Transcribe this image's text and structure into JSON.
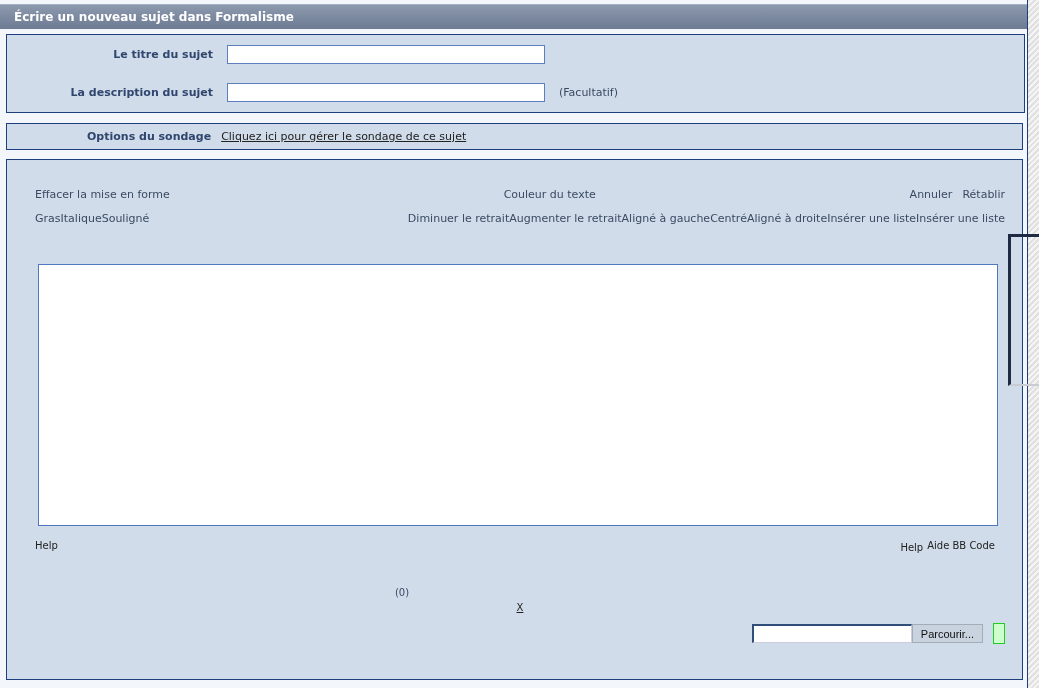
{
  "header": {
    "title": "Écrire un nouveau sujet dans Formalisme"
  },
  "topic_form": {
    "fields": [
      {
        "label": "Le titre du sujet"
      },
      {
        "label": "La description du sujet",
        "note": "(Facultatif)"
      }
    ]
  },
  "poll": {
    "label": "Options du sondage",
    "link": "Cliquez ici pour gérer le sondage de ce sujet"
  },
  "editor": {
    "toolbar": {
      "clear_format": "Effacer la mise en forme",
      "text_color": "Couleur du texte",
      "history": [
        "Annuler",
        "Rétablir"
      ],
      "style_buttons": [
        "Gras",
        "Italique",
        "Souligné"
      ],
      "layout_buttons": [
        "Diminuer le retrait",
        "Augmenter le retrait",
        "Aligné à gauche",
        "Centré",
        "Aligné à droite",
        "Insérer une liste",
        "Insérer une liste"
      ]
    },
    "help_left": "Help",
    "help_right": "Help",
    "bbcode_help": "Aide BB Code",
    "counter": "(0)",
    "close": "X",
    "upload": {
      "button": "Parcourir..."
    }
  }
}
